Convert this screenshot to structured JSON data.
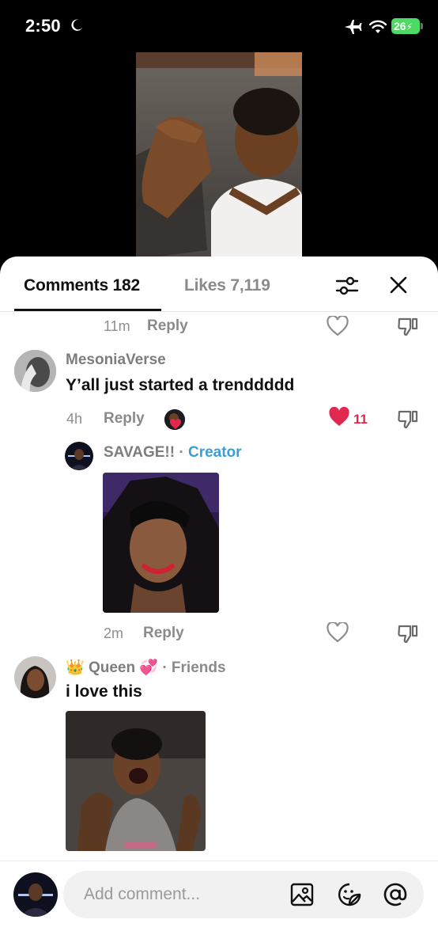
{
  "status_bar": {
    "time": "2:50",
    "battery": "26"
  },
  "tabs": {
    "comments_label": "Comments 182",
    "likes_label": "Likes 7,119"
  },
  "feed": {
    "partial_top": {
      "time": "11m",
      "reply_label": "Reply"
    },
    "comment1": {
      "username": "MesoniaVerse",
      "text": "Y’all just started a trenddddd",
      "time": "4h",
      "reply_label": "Reply",
      "like_count": "11"
    },
    "reply1": {
      "username": "SAVAGE!!",
      "separator": "·",
      "badge": "Creator",
      "time": "2m",
      "reply_label": "Reply"
    },
    "comment2": {
      "username": "Queen",
      "separator": "·",
      "badge": "Friends",
      "text": "i love this"
    }
  },
  "composer": {
    "placeholder": "Add comment..."
  },
  "colors": {
    "accent_red": "#e3284f",
    "creator_blue": "#3b9ed6",
    "battery_green": "#4cd964"
  },
  "icons": [
    "moon-icon",
    "airplane-icon",
    "wifi-icon",
    "filter-icon",
    "close-icon",
    "heart-icon",
    "dislike-icon",
    "image-icon",
    "sticker-icon",
    "at-icon"
  ]
}
